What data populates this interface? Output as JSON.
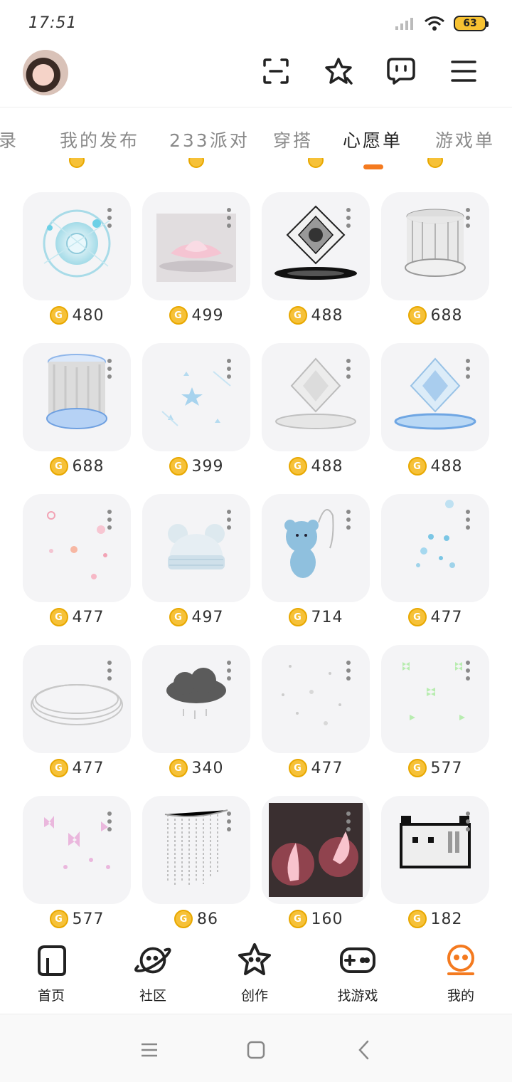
{
  "status": {
    "time": "17:51",
    "battery": "63"
  },
  "tabs": [
    {
      "label": "记录"
    },
    {
      "label": "我的发布"
    },
    {
      "label": "233派对"
    },
    {
      "label": "穿搭"
    },
    {
      "label": "心愿单"
    },
    {
      "label": "游戏单"
    }
  ],
  "active_tab": "心愿单",
  "items": [
    {
      "price": "480",
      "art": "ice-orb"
    },
    {
      "price": "499",
      "art": "pink-lotus"
    },
    {
      "price": "488",
      "art": "dark-crystal-stage"
    },
    {
      "price": "688",
      "art": "silver-pillar"
    },
    {
      "price": "688",
      "art": "blue-pillar"
    },
    {
      "price": "399",
      "art": "blue-stars"
    },
    {
      "price": "488",
      "art": "silver-crystal-stage"
    },
    {
      "price": "488",
      "art": "blue-crystal-stage"
    },
    {
      "price": "477",
      "art": "pink-sparkles"
    },
    {
      "price": "497",
      "art": "bear-beanie"
    },
    {
      "price": "714",
      "art": "blue-bear-charm"
    },
    {
      "price": "477",
      "art": "blue-sparkles"
    },
    {
      "price": "477",
      "art": "silver-rings"
    },
    {
      "price": "340",
      "art": "rain-cloud"
    },
    {
      "price": "477",
      "art": "star-dust"
    },
    {
      "price": "577",
      "art": "green-butterflies"
    },
    {
      "price": "577",
      "art": "pink-butterflies"
    },
    {
      "price": "86",
      "art": "bead-curtain"
    },
    {
      "price": "160",
      "art": "pink-horns"
    },
    {
      "price": "182",
      "art": "pixel-cat"
    }
  ],
  "bottom_nav": [
    {
      "label": "首页",
      "icon": "home-icon"
    },
    {
      "label": "社区",
      "icon": "planet-icon"
    },
    {
      "label": "创作",
      "icon": "star-face-icon"
    },
    {
      "label": "找游戏",
      "icon": "gamepad-icon"
    },
    {
      "label": "我的",
      "icon": "profile-face-icon"
    }
  ],
  "colors": {
    "accent": "#f47a1f",
    "coin": "#f6c138",
    "thumb_bg": "#f4f4f6",
    "inactive_tab": "#8a8a8a"
  }
}
